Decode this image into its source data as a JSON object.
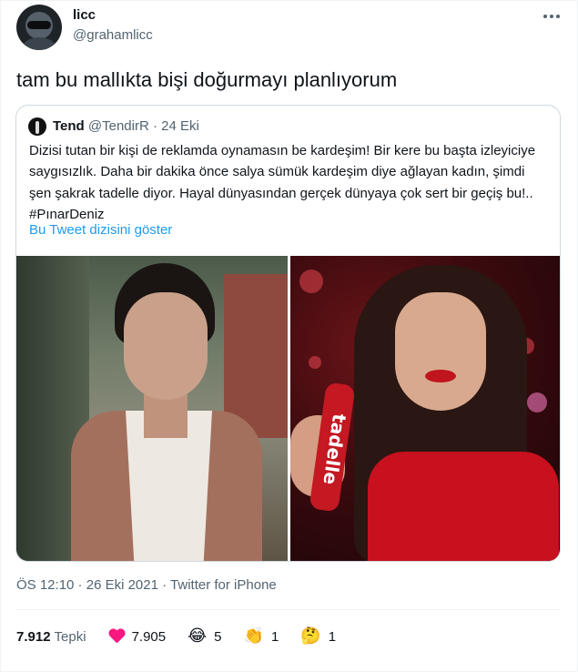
{
  "author": {
    "name": "licc",
    "handle": "@grahamlicc"
  },
  "tweet": {
    "text": "tam bu mallıkta bişi doğurmayı planlıyorum"
  },
  "quoted": {
    "name": "Tend",
    "handle": "@TendirR",
    "separator": " · ",
    "date": "24 Eki",
    "text": "Dizisi tutan bir kişi de reklamda oynamasın be kardeşim! Bir kere bu başta izleyiciye saygısızlık. Daha bir dakika önce salya sümük kardeşim diye ağlayan kadın, şimdi şen şakrak tadelle diyor. Hayal dünyasından gerçek dünyaya çok sert bir geçiş bu!.. #PınarDeniz",
    "show_thread": "Bu Tweet dizisini göster",
    "product_text": "tadelle"
  },
  "meta": {
    "time": "ÖS 12:10",
    "date": "26 Eki 2021",
    "source": "Twitter for iPhone",
    "separator": " · "
  },
  "stats": {
    "reactions_count": "7.912",
    "reactions_label": "Tepki",
    "likes": "7.905",
    "laugh_icon": "😂",
    "laugh": "5",
    "clap_icon": "👏",
    "clap": "1",
    "think_icon": "🤔",
    "think": "1"
  },
  "colors": {
    "accent": "#1d9bf0",
    "heart": "#f91880",
    "muted": "#536471"
  }
}
